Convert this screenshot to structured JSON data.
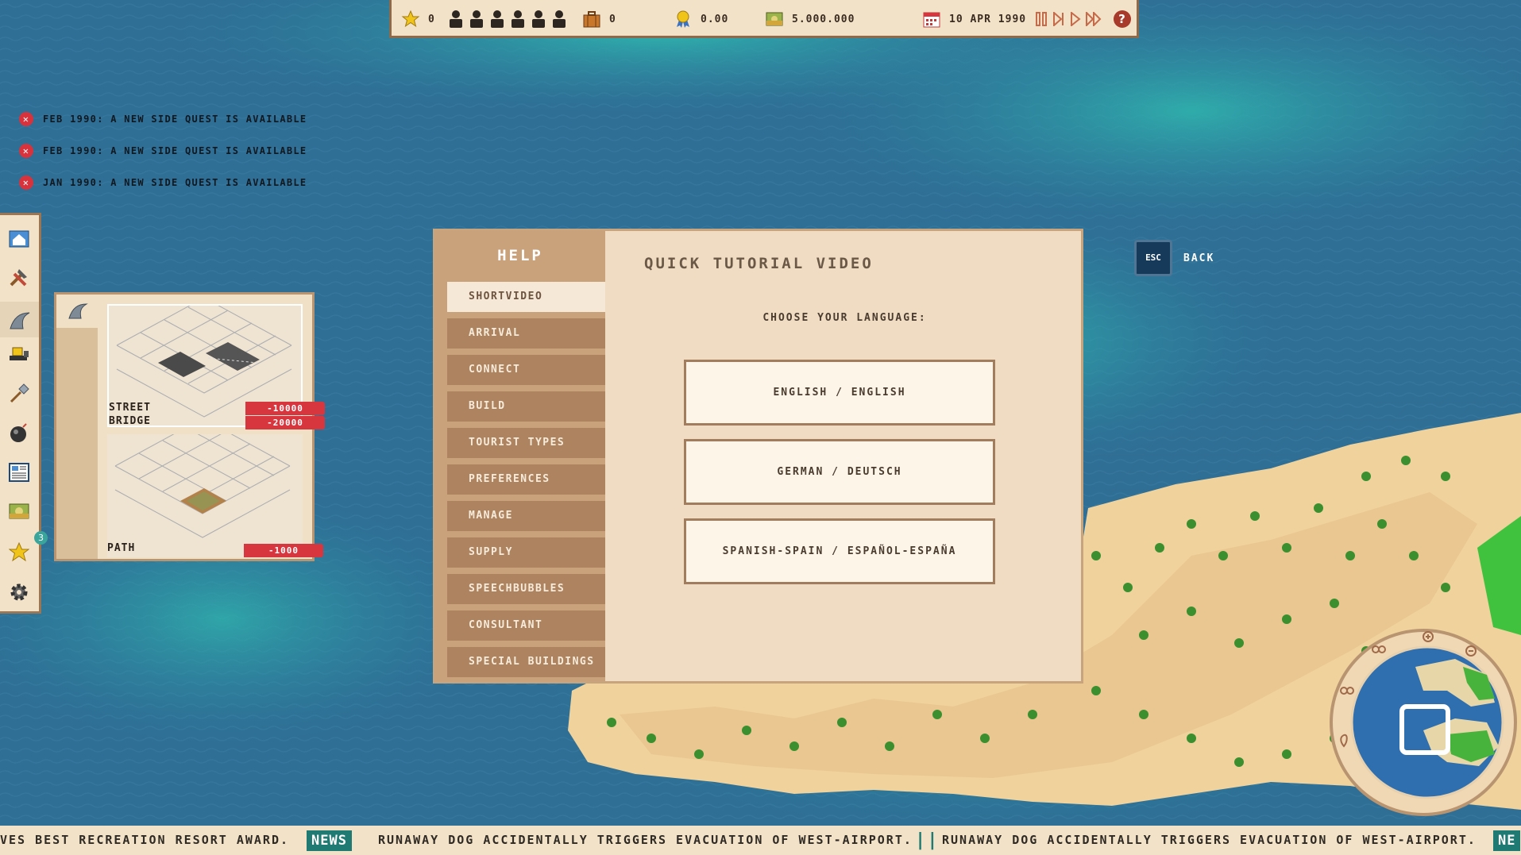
{
  "topbar": {
    "stars": "0",
    "suitcases": "0",
    "rating": "0.00",
    "money": "5.000.000",
    "date": "10 APR 1990"
  },
  "notifications": [
    {
      "text": "FEB 1990: A NEW SIDE QUEST IS AVAILABLE"
    },
    {
      "text": "FEB 1990: A NEW SIDE QUEST IS AVAILABLE"
    },
    {
      "text": "JAN 1990: A NEW SIDE QUEST IS AVAILABLE"
    }
  ],
  "toolbar": {
    "items": [
      "house-icon",
      "hammer-icon",
      "wave-icon",
      "bulldozer-icon",
      "shovel-icon",
      "bomb-icon",
      "newspaper-icon",
      "money-icon",
      "star-icon",
      "gear-icon"
    ],
    "star_badge": "3"
  },
  "build_panel": {
    "street_label": "STREET",
    "bridge_label": "BRIDGE",
    "street_price": "-10000",
    "bridge_price": "-20000",
    "path_label": "PATH",
    "path_price": "-1000"
  },
  "help": {
    "title": "HELP",
    "nav": [
      "SHORTVIDEO",
      "ARRIVAL",
      "CONNECT",
      "BUILD",
      "TOURIST TYPES",
      "PREFERENCES",
      "MANAGE",
      "SUPPLY",
      "SPEECHBUBBLES",
      "CONSULTANT",
      "SPECIAL BUILDINGS"
    ],
    "active_index": 0,
    "content_title": "QUICK TUTORIAL VIDEO",
    "language_prompt": "CHOOSE YOUR LANGUAGE:",
    "languages": [
      "ENGLISH / ENGLISH",
      "GERMAN / DEUTSCH",
      "SPANISH-SPAIN / ESPAÑOL-ESPAÑA"
    ]
  },
  "back": {
    "key": "ESC",
    "label": "BACK"
  },
  "ticker": {
    "segment1": "VES BEST RECREATION RESORT AWARD.",
    "news_tag": "NEWS",
    "segment2": "RUNAWAY DOG ACCIDENTALLY TRIGGERS EVACUATION OF WEST-AIRPORT.",
    "segment3": "RUNAWAY DOG ACCIDENTALLY TRIGGERS EVACUATION OF WEST-AIRPORT.",
    "news_tag_cut": "NE"
  },
  "colors": {
    "ocean_deep": "#2e6c93",
    "ocean_shallow": "#2aa0a6",
    "sand": "#f0d29c",
    "panel": "#f0dcc2",
    "nav": "#c9a27b",
    "accent_red": "#d8363f",
    "news_teal": "#1e7a72"
  }
}
